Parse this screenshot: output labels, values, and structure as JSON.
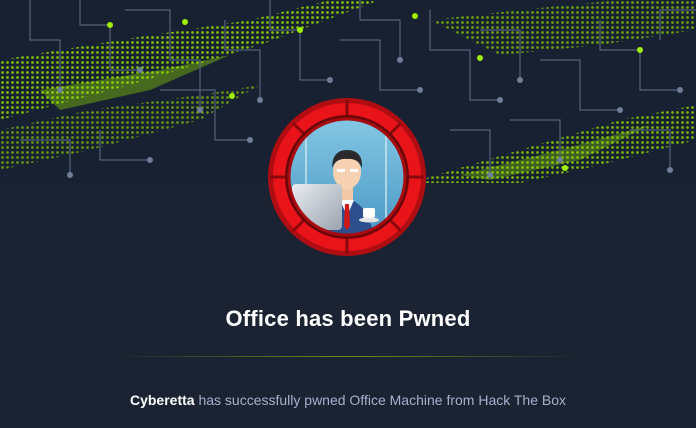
{
  "title": "Office has been Pwned",
  "message": {
    "user": "Cyberetta",
    "text": " has successfully pwned Office Machine from Hack The Box"
  },
  "colors": {
    "accent": "#9fef00",
    "background": "#1b2333",
    "ring": "#e8141a"
  }
}
